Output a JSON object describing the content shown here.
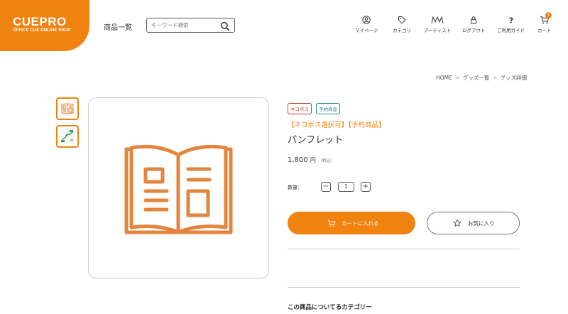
{
  "header": {
    "logo_main": "CUEPRO",
    "logo_sub": "OFFICE CUE ONLINE SHOP",
    "nav_products": "商品一覧",
    "search": {
      "placeholder": "キーワード検索",
      "icon": "search-icon"
    },
    "nav_items": [
      {
        "label": "マイページ",
        "icon": "user-icon"
      },
      {
        "label": "カテゴリ",
        "icon": "tag-icon"
      },
      {
        "label": "アーティスト",
        "icon": "artist-icon"
      },
      {
        "label": "ログアウト",
        "icon": "lock-icon"
      },
      {
        "label": "ご利用ガイド",
        "icon": "question-icon"
      },
      {
        "label": "カート",
        "icon": "cart-icon",
        "badge": "1"
      }
    ]
  },
  "breadcrumb": [
    "HOME",
    "グッズ一覧",
    "グッズ詳細"
  ],
  "gallery": {
    "thumbnails": [
      "book-thumbnail",
      "map-thumbnail"
    ],
    "main_icon": "open-book-icon"
  },
  "product": {
    "badges": [
      {
        "label": "ネコポス",
        "color": "#c0392b"
      },
      {
        "label": "予約商品",
        "color": "#1f8a99"
      }
    ],
    "tagline": "【ネコポス選択可】【予約商品】",
    "title": "パンフレット",
    "price": "1,800",
    "price_unit": "円",
    "price_tax": "（税込）",
    "quantity_label": "数量：",
    "quantity": "1",
    "add_to_cart": "カートに入れる",
    "favorite": "お気に入り",
    "category_heading": "この商品についてるカテゴリー"
  },
  "colors": {
    "accent": "#f0820f",
    "border": "#cccccc",
    "text": "#333333"
  }
}
